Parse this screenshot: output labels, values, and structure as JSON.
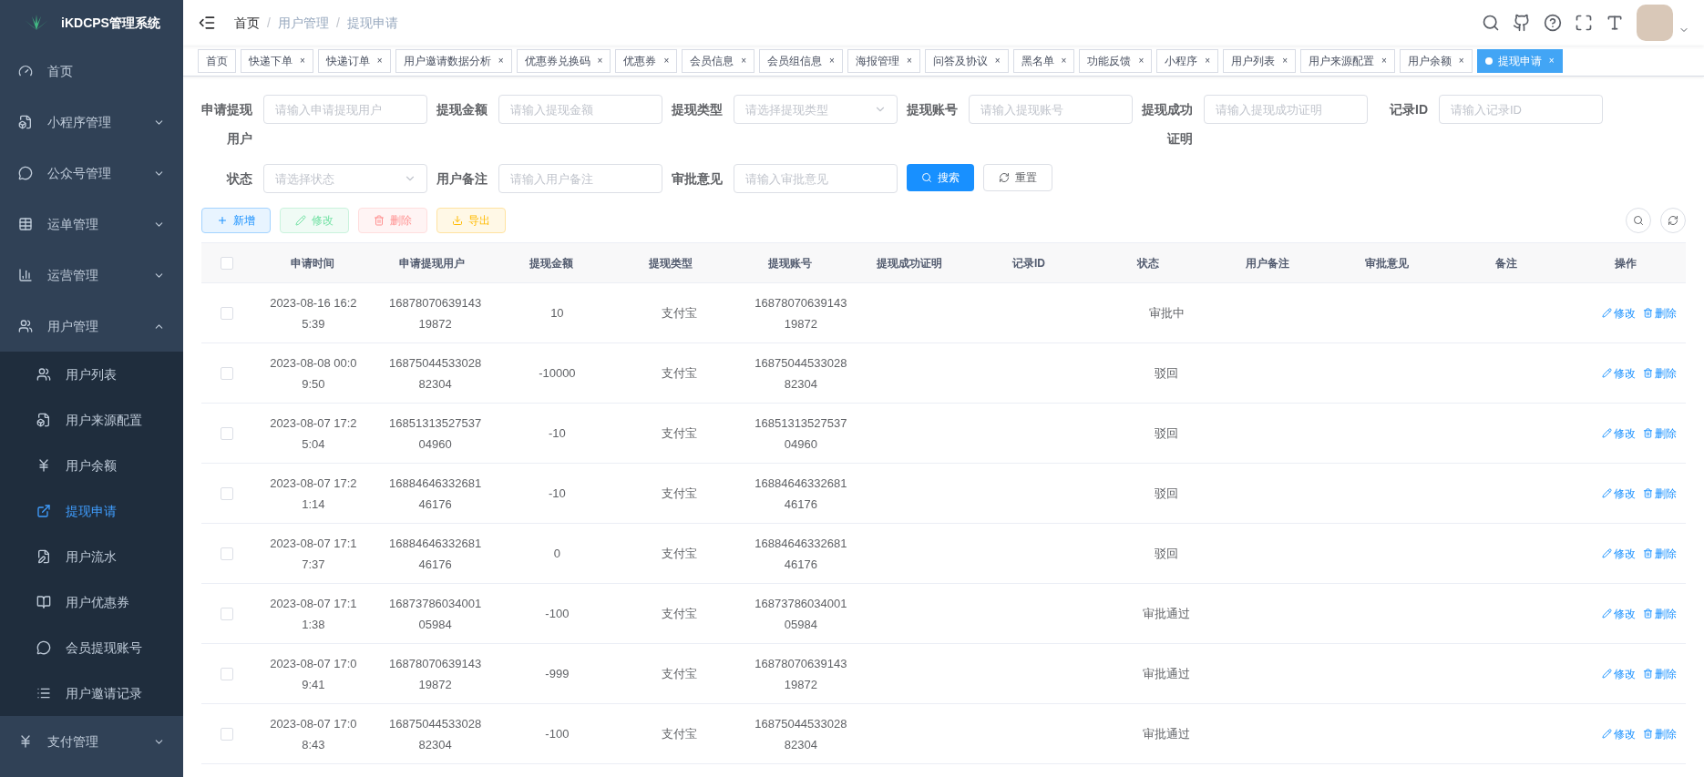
{
  "brand": "iKDCPS管理系统",
  "sidebar": {
    "items": [
      {
        "label": "首页",
        "selected": false
      },
      {
        "label": "小程序管理",
        "expanded": false,
        "selected": false
      },
      {
        "label": "公众号管理",
        "expanded": false,
        "selected": false
      },
      {
        "label": "运单管理",
        "expanded": false,
        "selected": false
      },
      {
        "label": "运营管理",
        "expanded": false,
        "selected": false
      },
      {
        "label": "用户管理",
        "expanded": true,
        "selected": false,
        "children": [
          {
            "label": "用户列表",
            "selected": false
          },
          {
            "label": "用户来源配置",
            "selected": false
          },
          {
            "label": "用户余额",
            "selected": false
          },
          {
            "label": "提现申请",
            "selected": true
          },
          {
            "label": "用户流水",
            "selected": false
          },
          {
            "label": "用户优惠券",
            "selected": false
          },
          {
            "label": "会员提现账号",
            "selected": false
          },
          {
            "label": "用户邀请记录",
            "selected": false
          }
        ]
      },
      {
        "label": "支付管理",
        "expanded": false,
        "selected": false
      }
    ]
  },
  "breadcrumb": {
    "items": [
      "首页",
      "用户管理",
      "提现申请"
    ],
    "separators": [
      "/",
      "/"
    ]
  },
  "tabs": [
    {
      "label": "首页",
      "selected": false
    },
    {
      "label": "快递下单",
      "close": "×",
      "selected": false
    },
    {
      "label": "快递订单",
      "close": "×",
      "selected": false
    },
    {
      "label": "用户邀请数据分析",
      "close": "×",
      "selected": false
    },
    {
      "label": "优惠券兑换码",
      "close": "×",
      "selected": false
    },
    {
      "label": "优惠券",
      "close": "×",
      "selected": false
    },
    {
      "label": "会员信息",
      "close": "×",
      "selected": false
    },
    {
      "label": "会员组信息",
      "close": "×",
      "selected": false
    },
    {
      "label": "海报管理",
      "close": "×",
      "selected": false
    },
    {
      "label": "问答及协议",
      "close": "×",
      "selected": false
    },
    {
      "label": "黑名单",
      "close": "×",
      "selected": false
    },
    {
      "label": "功能反馈",
      "close": "×",
      "selected": false
    },
    {
      "label": "小程序",
      "close": "×",
      "selected": false
    },
    {
      "label": "用户列表",
      "close": "×",
      "selected": false
    },
    {
      "label": "用户来源配置",
      "close": "×",
      "selected": false
    },
    {
      "label": "用户余额",
      "close": "×",
      "selected": false
    },
    {
      "label": "提现申请",
      "close": "×",
      "selected": true
    }
  ],
  "filters": [
    {
      "label": "申请提现用户",
      "kind": "input",
      "placeholder": "请输入申请提现用户"
    },
    {
      "label": "提现金额",
      "kind": "input",
      "placeholder": "请输入提现金额"
    },
    {
      "label": "提现类型",
      "kind": "select",
      "placeholder": "请选择提现类型"
    },
    {
      "label": "提现账号",
      "kind": "input",
      "placeholder": "请输入提现账号"
    },
    {
      "label": "提现成功证明",
      "kind": "input",
      "placeholder": "请输入提现成功证明"
    },
    {
      "label": "记录ID",
      "kind": "input",
      "placeholder": "请输入记录ID"
    },
    {
      "label": "状态",
      "kind": "select",
      "placeholder": "请选择状态"
    },
    {
      "label": "用户备注",
      "kind": "input",
      "placeholder": "请输入用户备注"
    },
    {
      "label": "审批意见",
      "kind": "input",
      "placeholder": "请输入审批意见"
    }
  ],
  "search_button": "搜索",
  "reset_button": "重置",
  "toolbar": [
    {
      "label": "新增",
      "kind": "primary",
      "disabled": false
    },
    {
      "label": "修改",
      "kind": "success",
      "disabled": true
    },
    {
      "label": "删除",
      "kind": "danger",
      "disabled": true
    },
    {
      "label": "导出",
      "kind": "warning",
      "disabled": false
    }
  ],
  "table": {
    "all_checked": false,
    "columns": [
      "申请时间",
      "申请提现用户",
      "提现金额",
      "提现类型",
      "提现账号",
      "提现成功证明",
      "记录ID",
      "状态",
      "用户备注",
      "审批意见",
      "备注",
      "操作"
    ],
    "rows": [
      {
        "checked": false,
        "cells": [
          "2023-08-16 16:25:39",
          "1687807063914319872",
          "10",
          "支付宝",
          "1687807063914319872",
          "",
          "",
          "审批中",
          "",
          "",
          ""
        ],
        "actions": [
          "修改",
          "删除"
        ]
      },
      {
        "checked": false,
        "cells": [
          "2023-08-08 00:09:50",
          "1687504453302882304",
          "-10000",
          "支付宝",
          "1687504453302882304",
          "",
          "",
          "驳回",
          "",
          "",
          ""
        ],
        "actions": [
          "修改",
          "删除"
        ]
      },
      {
        "checked": false,
        "cells": [
          "2023-08-07 17:25:04",
          "1685131352753704960",
          "-10",
          "支付宝",
          "1685131352753704960",
          "",
          "",
          "驳回",
          "",
          "",
          ""
        ],
        "actions": [
          "修改",
          "删除"
        ]
      },
      {
        "checked": false,
        "cells": [
          "2023-08-07 17:21:14",
          "1688464633268146176",
          "-10",
          "支付宝",
          "1688464633268146176",
          "",
          "",
          "驳回",
          "",
          "",
          ""
        ],
        "actions": [
          "修改",
          "删除"
        ]
      },
      {
        "checked": false,
        "cells": [
          "2023-08-07 17:17:37",
          "1688464633268146176",
          "0",
          "支付宝",
          "1688464633268146176",
          "",
          "",
          "驳回",
          "",
          "",
          ""
        ],
        "actions": [
          "修改",
          "删除"
        ]
      },
      {
        "checked": false,
        "cells": [
          "2023-08-07 17:11:38",
          "1687378603400105984",
          "-100",
          "支付宝",
          "1687378603400105984",
          "",
          "",
          "审批通过",
          "",
          "",
          ""
        ],
        "actions": [
          "修改",
          "删除"
        ]
      },
      {
        "checked": false,
        "cells": [
          "2023-08-07 17:09:41",
          "1687807063914319872",
          "-999",
          "支付宝",
          "1687807063914319872",
          "",
          "",
          "审批通过",
          "",
          "",
          ""
        ],
        "actions": [
          "修改",
          "删除"
        ]
      },
      {
        "checked": false,
        "cells": [
          "2023-08-07 17:08:43",
          "1687504453302882304",
          "-100",
          "支付宝",
          "1687504453302882304",
          "",
          "",
          "审批通过",
          "",
          "",
          ""
        ],
        "actions": [
          "修改",
          "删除"
        ]
      }
    ]
  }
}
